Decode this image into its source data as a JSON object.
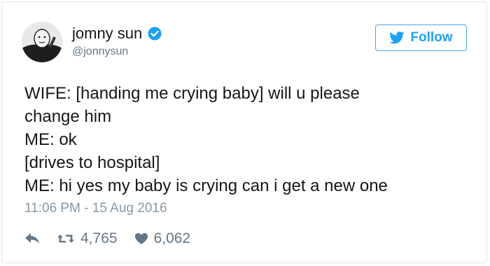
{
  "profile": {
    "display_name": "jomny sun",
    "handle": "@jonnysun",
    "verified": true,
    "avatar_icon": "avatar-image"
  },
  "follow_button": {
    "label": "Follow",
    "icon": "twitter-bird-icon"
  },
  "tweet": {
    "lines": [
      "WIFE: [handing me crying baby] will u please",
      "change him",
      "ME: ok",
      "[drives to hospital]",
      "ME: hi yes my baby is crying can i get a new one"
    ],
    "timestamp": "11:06 PM - 15 Aug 2016"
  },
  "actions": {
    "reply_icon": "reply-icon",
    "retweet_icon": "retweet-icon",
    "retweet_count": "4,765",
    "like_icon": "heart-icon",
    "like_count": "6,062"
  },
  "colors": {
    "accent": "#1da1f2",
    "text": "#14171a",
    "muted": "#657786",
    "timestamp": "#8899a6",
    "border": "#e1e8ed"
  }
}
